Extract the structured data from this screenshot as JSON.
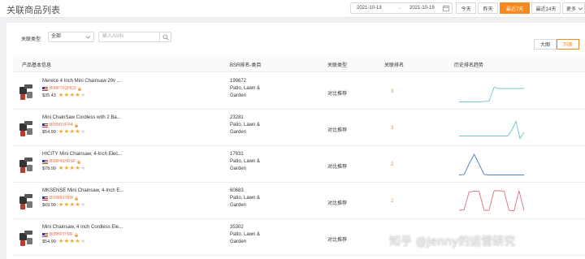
{
  "page": {
    "title": "关联商品列表"
  },
  "date_filter": {
    "start": "2021-10-13",
    "separator": "→",
    "end": "2021-10-19"
  },
  "quick_ranges": [
    {
      "label": "今天",
      "active": false
    },
    {
      "label": "昨天",
      "active": false
    },
    {
      "label": "最近7天",
      "active": true
    },
    {
      "label": "最近14天",
      "active": false
    },
    {
      "label": "更多",
      "active": false
    }
  ],
  "filters": {
    "type_label": "关联类型",
    "type_value": "全部",
    "search_placeholder": "输入ASIN"
  },
  "view_toggle": [
    {
      "label": "大图",
      "active": false
    },
    {
      "label": "列表",
      "active": true
    }
  ],
  "table": {
    "headers": [
      "产品基本信息",
      "BSR排名-类目",
      "关联类型",
      "关联排名",
      "历史排名趋势"
    ],
    "rows": [
      {
        "title": "Merece 4 Inch Mini Chainsaw 20v ...",
        "asin": "B08P7XQHQ3",
        "price": "$35.43",
        "rating": 4,
        "bsr": "199672",
        "category_1": "Patio, Lawn &",
        "category_2": "Garden",
        "type": "对比推荐",
        "rank": "3",
        "trend_color": "#6cc4c9",
        "trend": [
          0.95,
          0.95,
          0.95,
          0.95,
          0.95,
          0.93,
          0.92,
          0.35,
          0.4,
          0.4,
          0.4,
          0.4,
          0.4,
          0.4
        ]
      },
      {
        "title": "Mini ChainSaw Cordless with 2 Ba...",
        "asin": "B08M1VFR4",
        "price": "$54.99",
        "rating": 4,
        "bsr": "23281",
        "category_1": "Patio, Lawn &",
        "category_2": "Garden",
        "type": "对比推荐",
        "rank": "3",
        "trend_color": "#6cc4c9",
        "trend": [
          0.85,
          0.85,
          0.85,
          0.85,
          0.85,
          0.85,
          0.85,
          0.85,
          0.85,
          0.85,
          0.85,
          0.85,
          0.85,
          0.6,
          0.25,
          0.95,
          0.7
        ]
      },
      {
        "title": "HICITY Mini Chainsaw, 4-Inch Elec...",
        "asin": "B08P4SHRSF",
        "price": "$78.99",
        "rating": 4,
        "bsr": "17931",
        "category_1": "Patio, Lawn &",
        "category_2": "Garden",
        "type": "对比推荐",
        "rank": "2",
        "trend_color": "#4a80c8",
        "trend": [
          0.95,
          0.93,
          0.5,
          0.1,
          0.5,
          0.93,
          0.95,
          0.95,
          0.95,
          0.95,
          0.95,
          0.95,
          0.95,
          0.95
        ]
      },
      {
        "title": "MKSENSE Mini Chainsaw, 4-Inch E...",
        "asin": "B09RBJ7BW",
        "price": "$69.99",
        "rating": 4.5,
        "bsr": "60683",
        "category_1": "Patio, Lawn &",
        "category_2": "Garden",
        "type": "对比推荐",
        "rank": "2",
        "trend_color": "#e0707a",
        "trend": [
          0.9,
          0.88,
          0.15,
          0.12,
          0.12,
          0.9,
          0.9,
          0.1,
          0.1,
          0.12,
          0.9,
          0.92,
          0.1,
          0.9
        ]
      },
      {
        "title": "Mini Chainsaw, 4 Inch Cordless Ele...",
        "asin": "B08HPJYMF",
        "price": "$54.99",
        "rating": 4.5,
        "bsr": "35302",
        "category_1": "Patio, Lawn &",
        "category_2": "Garden",
        "type": "对比推荐",
        "rank": "",
        "trend_color": "",
        "trend": []
      }
    ]
  },
  "watermark": "知乎 @Jenny的运营研究"
}
